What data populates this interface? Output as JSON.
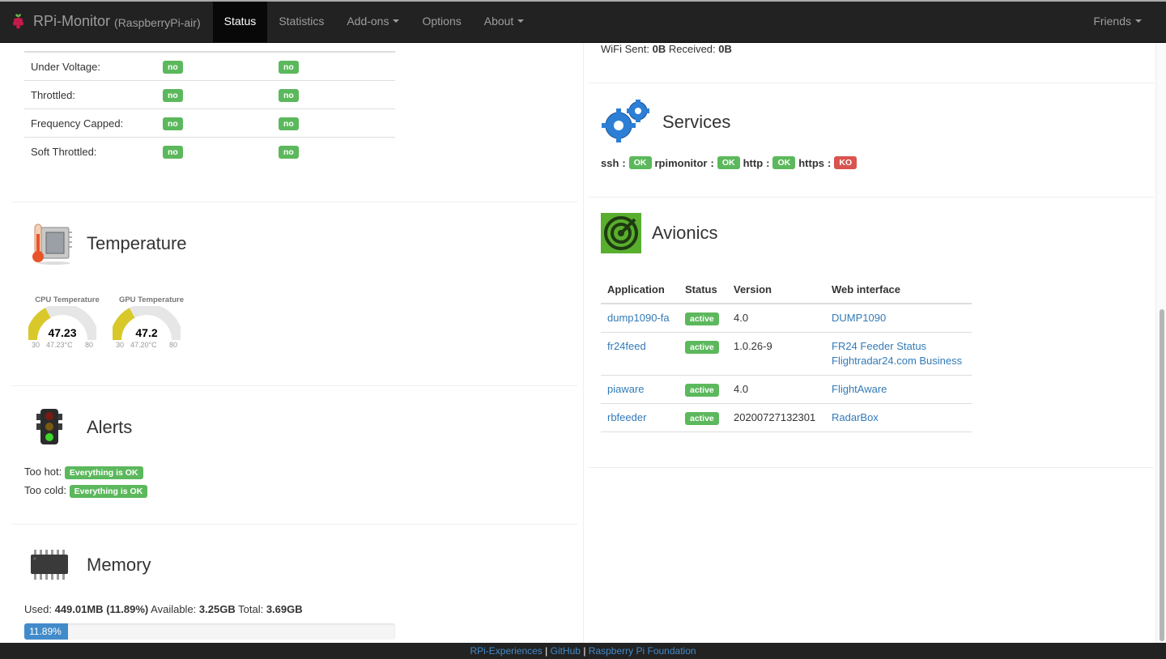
{
  "nav": {
    "brand": "RPi-Monitor",
    "host": "(RaspberryPi-air)",
    "items": [
      {
        "label": "Status"
      },
      {
        "label": "Statistics"
      },
      {
        "label": "Add-ons"
      },
      {
        "label": "Options"
      },
      {
        "label": "About"
      }
    ],
    "right": "Friends"
  },
  "throttling": {
    "rows": [
      {
        "label": "Under Voltage:",
        "now": "no",
        "past": "no"
      },
      {
        "label": "Throttled:",
        "now": "no",
        "past": "no"
      },
      {
        "label": "Frequency Capped:",
        "now": "no",
        "past": "no"
      },
      {
        "label": "Soft Throttled:",
        "now": "no",
        "past": "no"
      }
    ]
  },
  "temperature": {
    "title": "Temperature",
    "gauges": [
      {
        "title": "CPU Temperature",
        "value": "47.23",
        "sub": "47.23°C",
        "min": "30",
        "max": "80",
        "level": 0.345
      },
      {
        "title": "GPU Temperature",
        "value": "47.2",
        "sub": "47.20°C",
        "min": "30",
        "max": "80",
        "level": 0.344
      }
    ]
  },
  "alerts": {
    "title": "Alerts",
    "hot_label": "Too hot:",
    "hot_status": "Everything is OK",
    "cold_label": "Too cold:",
    "cold_status": "Everything is OK"
  },
  "memory": {
    "title": "Memory",
    "used_label": "Used:",
    "used": "449.01MB",
    "used_pct": "(11.89%)",
    "avail_label": "Available:",
    "avail": "3.25GB",
    "total_label": "Total:",
    "total": "3.69GB",
    "bar_text": "11.89%",
    "bar_fraction": 0.1189
  },
  "wifi": {
    "sent_label": "WiFi Sent:",
    "sent": "0B",
    "recv_label": "Received:",
    "recv": "0B"
  },
  "services": {
    "title": "Services",
    "items": [
      {
        "name": "ssh",
        "status": "OK"
      },
      {
        "name": "rpimonitor",
        "status": "OK"
      },
      {
        "name": "http",
        "status": "OK"
      },
      {
        "name": "https",
        "status": "KO"
      }
    ]
  },
  "avionics": {
    "title": "Avionics",
    "headers": [
      "Application",
      "Status",
      "Version",
      "Web interface"
    ],
    "rows": [
      {
        "app": "dump1090-fa",
        "status": "active",
        "version": "4.0",
        "links": [
          "DUMP1090"
        ]
      },
      {
        "app": "fr24feed",
        "status": "active",
        "version": "1.0.26-9",
        "links": [
          "FR24 Feeder Status",
          "Flightradar24.com Business"
        ]
      },
      {
        "app": "piaware",
        "status": "active",
        "version": "4.0",
        "links": [
          "FlightAware"
        ]
      },
      {
        "app": "rbfeeder",
        "status": "active",
        "version": "20200727132301",
        "links": [
          "RadarBox"
        ]
      }
    ]
  },
  "footer": {
    "link1": "RPi-Experiences",
    "link2": "GitHub",
    "link3": "Raspberry Pi Foundation",
    "sep": "|"
  },
  "colors": {
    "green": "#5cb85c",
    "red": "#d9534f",
    "gauge": "#d9c82a",
    "link": "#337ab7"
  }
}
